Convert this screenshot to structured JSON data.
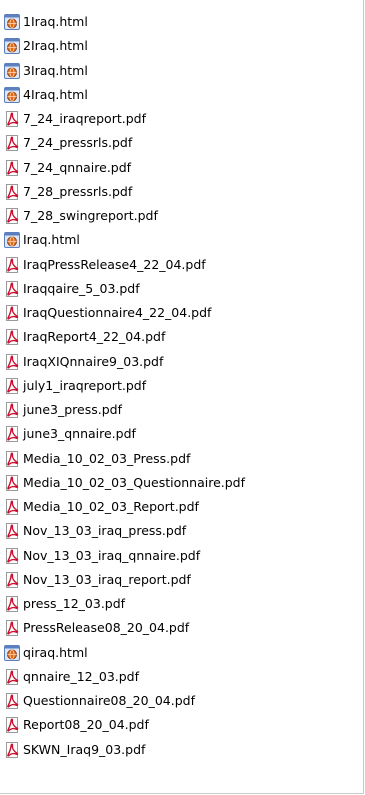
{
  "files": [
    {
      "name": "1Iraq.html",
      "type": "html",
      "icon": "html-file-icon"
    },
    {
      "name": "2Iraq.html",
      "type": "html",
      "icon": "html-file-icon"
    },
    {
      "name": "3Iraq.html",
      "type": "html",
      "icon": "html-file-icon"
    },
    {
      "name": "4Iraq.html",
      "type": "html",
      "icon": "html-file-icon"
    },
    {
      "name": "7_24_iraqreport.pdf",
      "type": "pdf",
      "icon": "pdf-file-icon"
    },
    {
      "name": "7_24_pressrls.pdf",
      "type": "pdf",
      "icon": "pdf-file-icon"
    },
    {
      "name": "7_24_qnnaire.pdf",
      "type": "pdf",
      "icon": "pdf-file-icon"
    },
    {
      "name": "7_28_pressrls.pdf",
      "type": "pdf",
      "icon": "pdf-file-icon"
    },
    {
      "name": "7_28_swingreport.pdf",
      "type": "pdf",
      "icon": "pdf-file-icon"
    },
    {
      "name": "Iraq.html",
      "type": "html",
      "icon": "html-file-icon"
    },
    {
      "name": "IraqPressRelease4_22_04.pdf",
      "type": "pdf",
      "icon": "pdf-file-icon"
    },
    {
      "name": "Iraqqaire_5_03.pdf",
      "type": "pdf",
      "icon": "pdf-file-icon"
    },
    {
      "name": "IraqQuestionnaire4_22_04.pdf",
      "type": "pdf",
      "icon": "pdf-file-icon"
    },
    {
      "name": "IraqReport4_22_04.pdf",
      "type": "pdf",
      "icon": "pdf-file-icon"
    },
    {
      "name": "IraqXIQnnaire9_03.pdf",
      "type": "pdf",
      "icon": "pdf-file-icon"
    },
    {
      "name": "july1_iraqreport.pdf",
      "type": "pdf",
      "icon": "pdf-file-icon"
    },
    {
      "name": "june3_press.pdf",
      "type": "pdf",
      "icon": "pdf-file-icon"
    },
    {
      "name": "june3_qnnaire.pdf",
      "type": "pdf",
      "icon": "pdf-file-icon"
    },
    {
      "name": "Media_10_02_03_Press.pdf",
      "type": "pdf",
      "icon": "pdf-file-icon"
    },
    {
      "name": "Media_10_02_03_Questionnaire.pdf",
      "type": "pdf",
      "icon": "pdf-file-icon"
    },
    {
      "name": "Media_10_02_03_Report.pdf",
      "type": "pdf",
      "icon": "pdf-file-icon"
    },
    {
      "name": "Nov_13_03_iraq_press.pdf",
      "type": "pdf",
      "icon": "pdf-file-icon"
    },
    {
      "name": "Nov_13_03_iraq_qnnaire.pdf",
      "type": "pdf",
      "icon": "pdf-file-icon"
    },
    {
      "name": "Nov_13_03_iraq_report.pdf",
      "type": "pdf",
      "icon": "pdf-file-icon"
    },
    {
      "name": "press_12_03.pdf",
      "type": "pdf",
      "icon": "pdf-file-icon"
    },
    {
      "name": "PressRelease08_20_04.pdf",
      "type": "pdf",
      "icon": "pdf-file-icon"
    },
    {
      "name": "qiraq.html",
      "type": "html",
      "icon": "html-file-icon"
    },
    {
      "name": "qnnaire_12_03.pdf",
      "type": "pdf",
      "icon": "pdf-file-icon"
    },
    {
      "name": "Questionnaire08_20_04.pdf",
      "type": "pdf",
      "icon": "pdf-file-icon"
    },
    {
      "name": "Report08_20_04.pdf",
      "type": "pdf",
      "icon": "pdf-file-icon"
    },
    {
      "name": "SKWN_Iraq9_03.pdf",
      "type": "pdf",
      "icon": "pdf-file-icon"
    }
  ],
  "colors": {
    "pdf_icon": "#c8102e",
    "html_icon_frame": "#5b7fbf",
    "html_icon_globe": "#e06a1b",
    "text": "#000000",
    "background": "#ffffff"
  }
}
